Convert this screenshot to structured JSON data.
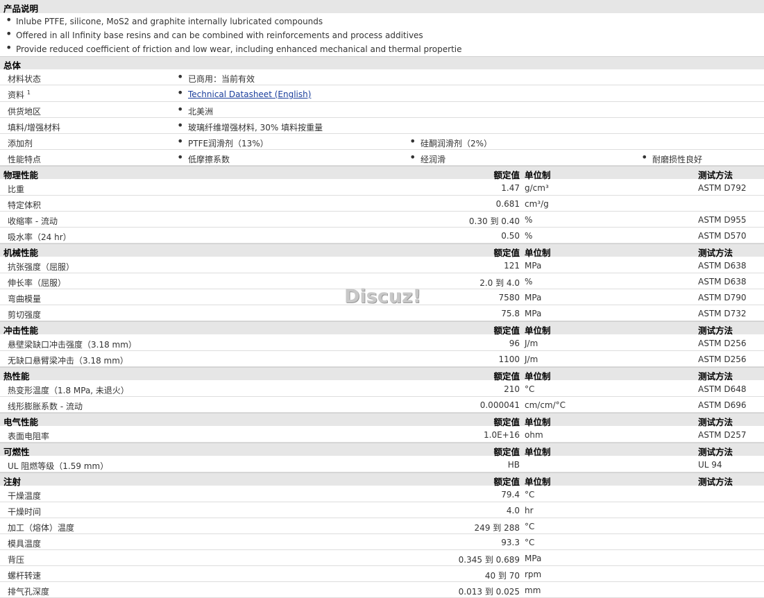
{
  "product": {
    "title": "产品说明",
    "bullets": [
      "Inlube PTFE, silicone, MoS2 and graphite internally lubricated compounds",
      "Offered in all Infinity base resins and can be combined with reinforcements and process additives",
      "Provide reduced coefficient of friction and low wear, including enhanced mechanical and thermal propertie"
    ]
  },
  "general": {
    "title": "总体",
    "status_label": "材料状态",
    "status_value": "已商用：当前有效",
    "doc_label": "资料",
    "doc_sup": "1",
    "doc_link": "Technical Datasheet (English)",
    "region_label": "供货地区",
    "region_value": "北美洲",
    "filler_label": "填料/增强材料",
    "filler_value": "玻璃纤维增强材料, 30% 填料按重量",
    "additive_label": "添加剂",
    "additive_1": "PTFE润滑剂（13%）",
    "additive_2": "硅酮润滑剂（2%）",
    "feature_label": "性能特点",
    "feature_1": "低摩擦系数",
    "feature_2": "经润滑",
    "feature_3": "耐磨损性良好"
  },
  "headers": {
    "value": "额定值",
    "unit": "单位制",
    "test": "测试方法"
  },
  "sections": [
    {
      "title": "物理性能",
      "rows": [
        {
          "label": "比重",
          "value": "1.47",
          "unit": "g/cm³",
          "test": "ASTM D792"
        },
        {
          "label": "特定体积",
          "value": "0.681",
          "unit": "cm³/g",
          "test": ""
        },
        {
          "label": "收缩率 - 流动",
          "value": "0.30 到  0.40",
          "unit": "%",
          "test": "ASTM D955"
        },
        {
          "label": "吸水率（24 hr）",
          "value": "0.50",
          "unit": "%",
          "test": "ASTM D570"
        }
      ]
    },
    {
      "title": "机械性能",
      "rows": [
        {
          "label": "抗张强度（屈服）",
          "value": "121",
          "unit": "MPa",
          "test": "ASTM D638"
        },
        {
          "label": "伸长率（屈服）",
          "value": "2.0 到  4.0",
          "unit": "%",
          "test": "ASTM D638"
        },
        {
          "label": "弯曲模量",
          "value": "7580",
          "unit": "MPa",
          "test": "ASTM D790"
        },
        {
          "label": "剪切强度",
          "value": "75.8",
          "unit": "MPa",
          "test": "ASTM D732"
        }
      ]
    },
    {
      "title": "冲击性能",
      "rows": [
        {
          "label": "悬壁梁缺口冲击强度（3.18 mm）",
          "value": "96",
          "unit": "J/m",
          "test": "ASTM D256"
        },
        {
          "label": "无缺口悬臂梁冲击（3.18 mm）",
          "value": "1100",
          "unit": "J/m",
          "test": "ASTM D256"
        }
      ]
    },
    {
      "title": "热性能",
      "rows": [
        {
          "label": "热变形温度（1.8 MPa, 未退火）",
          "value": "210",
          "unit": "°C",
          "test": "ASTM D648"
        },
        {
          "label": "线形膨胀系数 - 流动",
          "value": "0.000041",
          "unit": "cm/cm/°C",
          "test": "ASTM D696"
        }
      ]
    },
    {
      "title": "电气性能",
      "rows": [
        {
          "label": "表面电阻率",
          "value": "1.0E+16",
          "unit": "ohm",
          "test": "ASTM D257"
        }
      ]
    },
    {
      "title": "可燃性",
      "rows": [
        {
          "label": "UL 阻燃等级（1.59 mm）",
          "value": "HB",
          "unit": "",
          "test": "UL 94"
        }
      ]
    },
    {
      "title": "注射",
      "rows": [
        {
          "label": "干燥温度",
          "value": "79.4",
          "unit": "°C",
          "test": ""
        },
        {
          "label": "干燥时间",
          "value": "4.0",
          "unit": "hr",
          "test": ""
        },
        {
          "label": "加工（熔体）温度",
          "value": "249 到  288",
          "unit": "°C",
          "test": ""
        },
        {
          "label": "模具温度",
          "value": "93.3",
          "unit": "°C",
          "test": ""
        },
        {
          "label": "背压",
          "value": "0.345 到  0.689",
          "unit": "MPa",
          "test": ""
        },
        {
          "label": "螺杆转速",
          "value": "40 到  70",
          "unit": "rpm",
          "test": ""
        },
        {
          "label": "排气孔深度",
          "value": "0.013 到  0.025",
          "unit": "mm",
          "test": ""
        }
      ]
    }
  ],
  "watermark": "Discuz!"
}
